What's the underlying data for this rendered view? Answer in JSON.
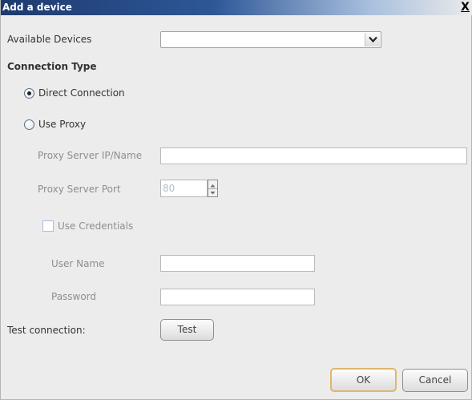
{
  "window": {
    "title": "Add a device",
    "close_label": "X"
  },
  "device": {
    "label": "Available Devices",
    "selected": ""
  },
  "connection": {
    "heading": "Connection Type",
    "direct_label": "Direct Connection",
    "proxy_label": "Use Proxy",
    "direct_selected": true
  },
  "proxy": {
    "server_label": "Proxy Server IP/Name",
    "server_value": "",
    "port_label": "Proxy Server Port",
    "port_value": "80",
    "credentials_label": "Use Credentials",
    "credentials_checked": false,
    "username_label": "User Name",
    "username_value": "",
    "password_label": "Password",
    "password_value": ""
  },
  "test": {
    "label": "Test connection:",
    "button": "Test"
  },
  "footer": {
    "ok": "OK",
    "cancel": "Cancel"
  },
  "icons": {
    "dropdown": "chevron-down-icon",
    "spinner_up": "triangle-up-icon",
    "spinner_down": "triangle-down-icon",
    "close": "close-icon"
  },
  "colors": {
    "title_bar_start": "#1e3a6e",
    "ok_focus_border": "#e1b56c",
    "disabled_text": "#8e8e8e"
  }
}
